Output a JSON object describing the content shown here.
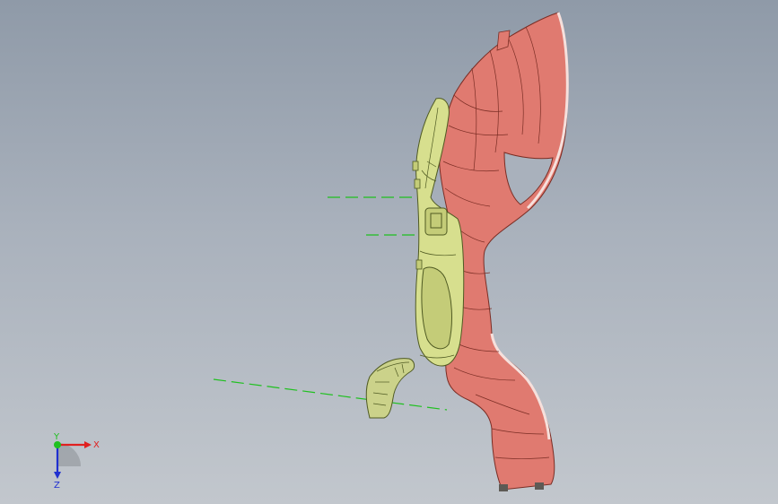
{
  "viewport": {
    "background_top": "#8f9aa8",
    "background_bottom": "#c2c7cd"
  },
  "parts": {
    "main_panel_color": "#e07a70",
    "main_panel_edge_color": "#f6e0dc",
    "inner_panel_color": "#d7df8e",
    "small_part_color": "#cbd28a",
    "line_color": "#7a2d24"
  },
  "axis_triad": {
    "x_label": "X",
    "y_label": "Y",
    "z_label": "Z",
    "x_color": "#e02020",
    "y_color": "#20c020",
    "z_color": "#2030d0"
  },
  "guides": {
    "color": "#1fc01f"
  }
}
